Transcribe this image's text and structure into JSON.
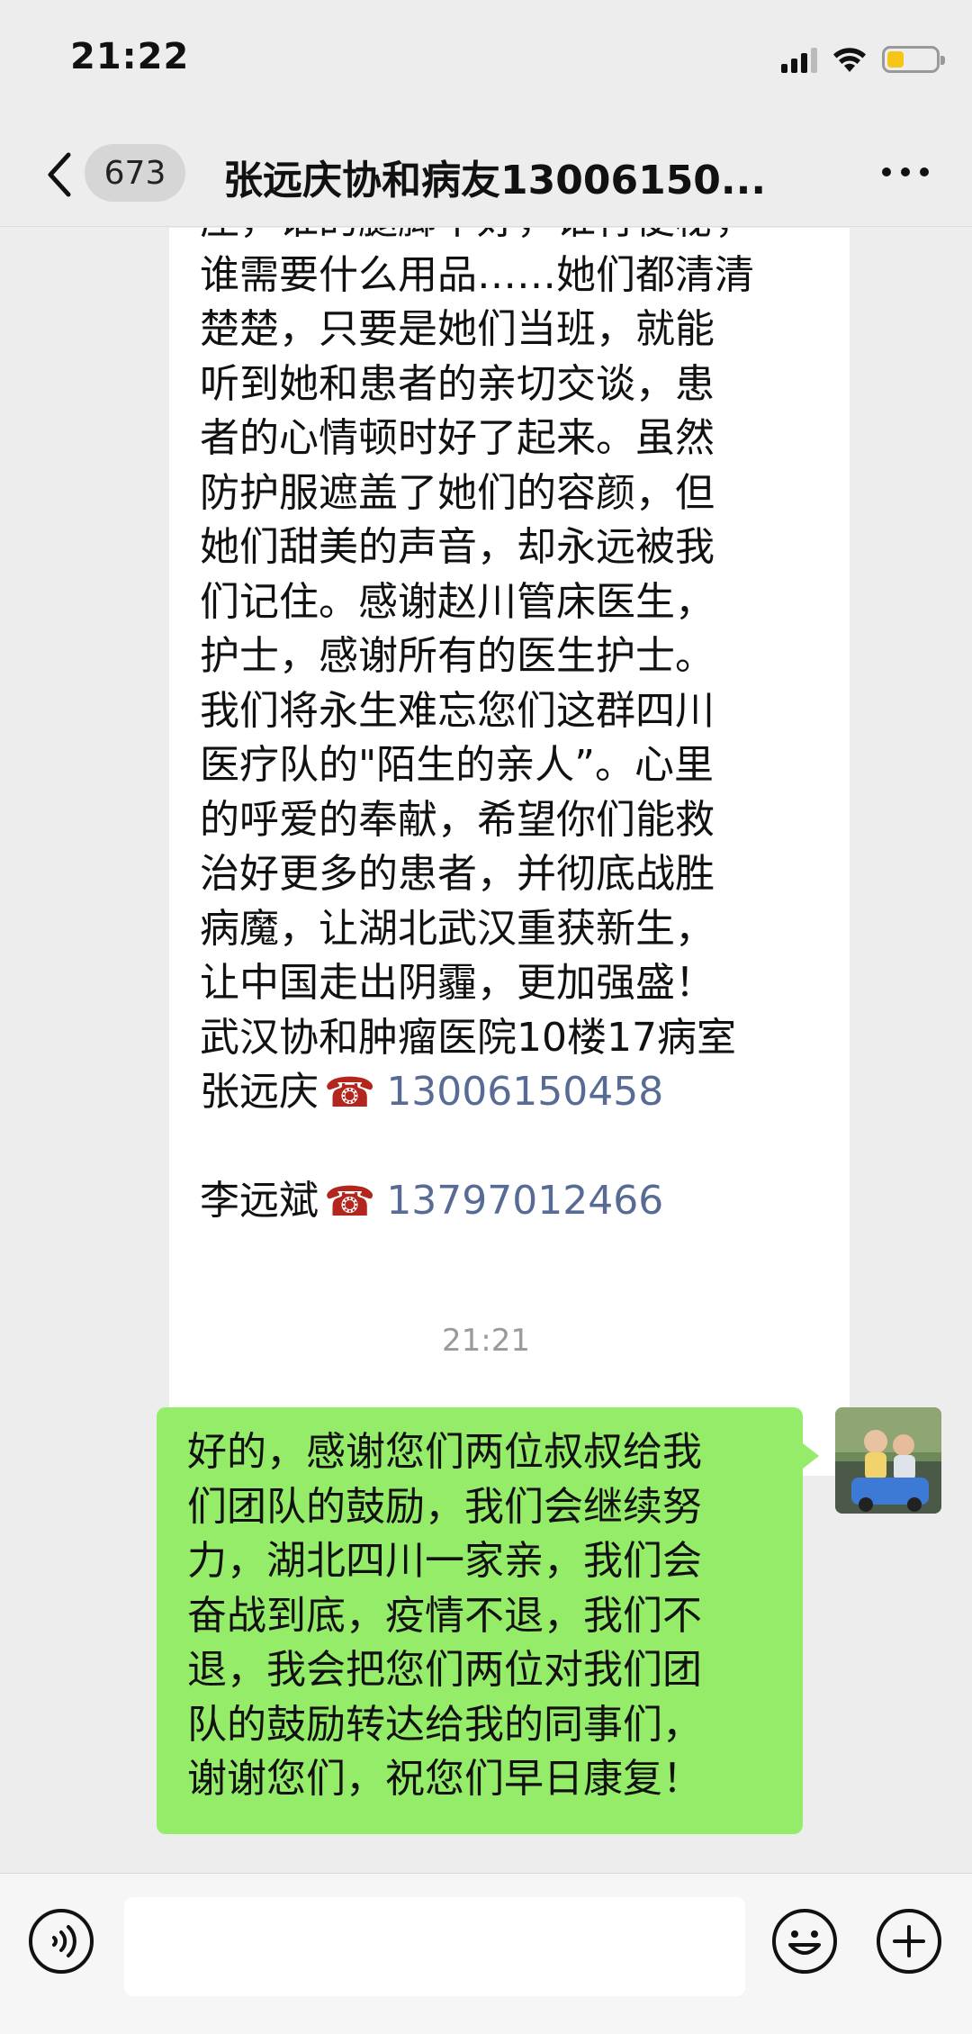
{
  "status_bar": {
    "time": "21:22"
  },
  "nav": {
    "unread_count": "673",
    "title": "张远庆协和病友13006150..."
  },
  "incoming_message": {
    "lines": [
      "庄，谁的腿脚不好，谁行便秘，",
      "谁需要什么用品……她们都清清",
      "楚楚，只要是她们当班，就能",
      "听到她和患者的亲切交谈，患",
      "者的心情顿时好了起来。虽然",
      "防护服遮盖了她们的容颜，但",
      "她们甜美的声音，却永远被我",
      "们记住。感谢赵川管床医生，",
      "护士，感谢所有的医生护士。",
      "我们将永生难忘您们这群四川",
      "医疗队的\"陌生的亲人”。心里",
      "的呼爱的奉献，希望你们能救",
      "治好更多的患者，并彻底战胜",
      "病魔，让湖北武汉重获新生，",
      "让中国走出阴霾，更加强盛！",
      "武汉协和肿瘤医院10楼17病室"
    ],
    "contact_1_name": "张远庆",
    "contact_1_phone": "13006150458",
    "contact_2_name": "李远斌",
    "contact_2_phone": "13797012466",
    "phone_icon": "☎"
  },
  "timestamp": "21:21",
  "outgoing_message": {
    "lines": [
      "好的，感谢您们两位叔叔给我",
      "们团队的鼓励，我们会继续努",
      "力，湖北四川一家亲，我们会",
      "奋战到底，疫情不退，我们不",
      "退，我会把您们两位对我们团",
      "队的鼓励转达给我的同事们，",
      "谢谢您们，祝您们早日康复！"
    ]
  },
  "icons": {
    "back": "chevron-left-icon",
    "more": "more-dots-icon",
    "voice": "voice-icon",
    "emoji": "emoji-icon",
    "plus": "plus-icon",
    "phone": "telephone-icon"
  },
  "colors": {
    "outgoing_bubble": "#95ec69",
    "incoming_bubble": "#ffffff",
    "phone_link": "#576b95",
    "background": "#ededed"
  }
}
